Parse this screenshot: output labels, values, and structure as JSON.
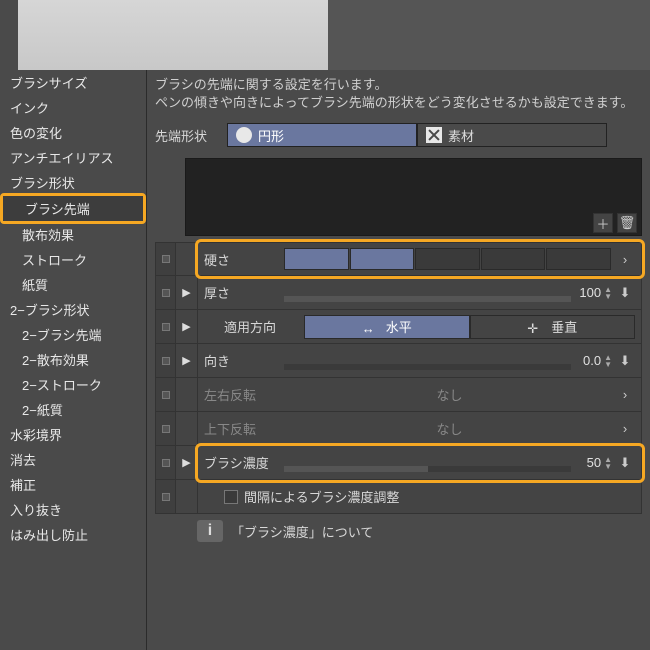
{
  "sidebar": {
    "items": [
      {
        "label": "ブラシサイズ"
      },
      {
        "label": "インク"
      },
      {
        "label": "色の変化"
      },
      {
        "label": "アンチエイリアス"
      },
      {
        "label": "ブラシ形状"
      },
      {
        "label": "ブラシ先端",
        "sub": true,
        "active": true
      },
      {
        "label": "散布効果",
        "sub": true
      },
      {
        "label": "ストローク",
        "sub": true
      },
      {
        "label": "紙質",
        "sub": true
      },
      {
        "label": "2−ブラシ形状"
      },
      {
        "label": "2−ブラシ先端",
        "sub": true
      },
      {
        "label": "2−散布効果",
        "sub": true
      },
      {
        "label": "2−ストローク",
        "sub": true
      },
      {
        "label": "2−紙質",
        "sub": true
      },
      {
        "label": "水彩境界"
      },
      {
        "label": "消去"
      },
      {
        "label": "補正"
      },
      {
        "label": "入り抜き"
      },
      {
        "label": "はみ出し防止"
      }
    ]
  },
  "desc": {
    "line1": "ブラシの先端に関する設定を行います。",
    "line2": "ペンの傾きや向きによってブラシ先端の形状をどう変化させるかも設定できます。"
  },
  "shape": {
    "label": "先端形状",
    "circle": "円形",
    "material": "素材"
  },
  "params": {
    "hardness": {
      "label": "硬さ"
    },
    "thickness": {
      "label": "厚さ",
      "value": "100"
    },
    "direction": {
      "label": "適用方向",
      "h": "水平",
      "v": "垂直"
    },
    "angle": {
      "label": "向き",
      "value": "0.0"
    },
    "fliph": {
      "label": "左右反転",
      "value": "なし"
    },
    "flipv": {
      "label": "上下反転",
      "value": "なし"
    },
    "density": {
      "label": "ブラシ濃度",
      "value": "50"
    },
    "spacing": {
      "label": "間隔によるブラシ濃度調整"
    },
    "info": {
      "label": "「ブラシ濃度」について"
    }
  }
}
